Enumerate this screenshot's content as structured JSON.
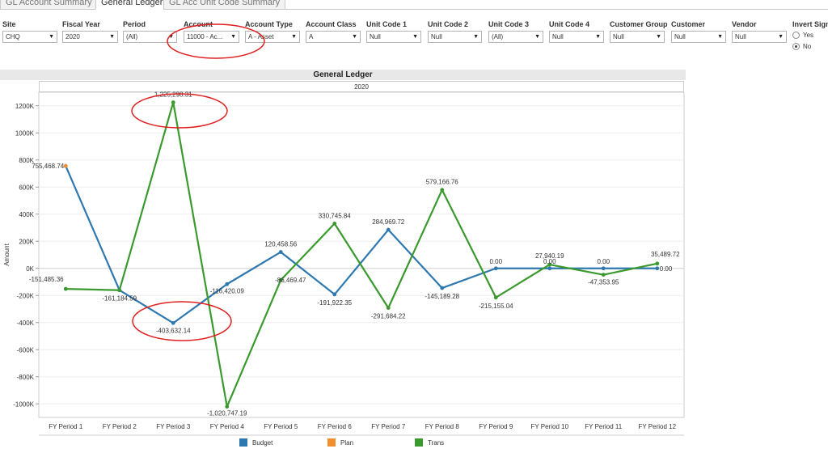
{
  "tabs": [
    {
      "label": "GL Account Summary",
      "active": false
    },
    {
      "label": "General Ledger",
      "active": true
    },
    {
      "label": "GL Acc Unit Code Summary",
      "active": false
    }
  ],
  "filters": [
    {
      "label": "Site",
      "value": "CHQ"
    },
    {
      "label": "Fiscal Year",
      "value": "2020"
    },
    {
      "label": "Period",
      "value": "(All)"
    },
    {
      "label": "Account",
      "value": "11000 - Ac..."
    },
    {
      "label": "Account Type",
      "value": "A - Asset"
    },
    {
      "label": "Account Class",
      "value": "A"
    },
    {
      "label": "Unit Code 1",
      "value": "Null"
    },
    {
      "label": "Unit Code 2",
      "value": "Null"
    },
    {
      "label": "Unit Code 3",
      "value": "(All)"
    },
    {
      "label": "Unit Code 4",
      "value": "Null"
    },
    {
      "label": "Customer Group",
      "value": "Null"
    },
    {
      "label": "Customer",
      "value": "Null"
    },
    {
      "label": "Vendor",
      "value": "Null"
    }
  ],
  "invert_sign": {
    "label": "Invert Sign",
    "options": [
      "Yes",
      "No"
    ],
    "selected": "No"
  },
  "chart_data": {
    "type": "line",
    "title": "General Ledger",
    "subtitle": "2020",
    "xlabel": "",
    "ylabel": "Amount",
    "ylim": [
      -1000000,
      1200000
    ],
    "yticks": [
      {
        "value": 1200000,
        "label": "1200K"
      },
      {
        "value": 1000000,
        "label": "1000K"
      },
      {
        "value": 800000,
        "label": "800K"
      },
      {
        "value": 600000,
        "label": "600K"
      },
      {
        "value": 400000,
        "label": "400K"
      },
      {
        "value": 200000,
        "label": "200K"
      },
      {
        "value": 0,
        "label": "0K"
      },
      {
        "value": -200000,
        "label": "-200K"
      },
      {
        "value": -400000,
        "label": "-400K"
      },
      {
        "value": -600000,
        "label": "-600K"
      },
      {
        "value": -800000,
        "label": "-800K"
      },
      {
        "value": -1000000,
        "label": "-1000K"
      }
    ],
    "categories": [
      "FY Period 1",
      "FY Period 2",
      "FY Period 3",
      "FY Period 4",
      "FY Period 5",
      "FY Period 6",
      "FY Period 7",
      "FY Period 8",
      "FY Period 9",
      "FY Period 10",
      "FY Period 11",
      "FY Period 12"
    ],
    "series": [
      {
        "name": "Budget",
        "color": "#2e78b0",
        "values": [
          755468.74,
          -161184.59,
          -403632.14,
          -116420.09,
          120458.56,
          -191922.35,
          284969.72,
          -145189.28,
          0,
          0,
          0,
          0
        ],
        "labels": [
          "",
          "-161,184.59",
          "-403,632.14",
          "-116,420.09",
          "120,458.56",
          "-191,922.35",
          "284,969.72",
          "-145,189.28",
          "0.00",
          "0.00",
          "0.00",
          "0.00"
        ]
      },
      {
        "name": "Plan",
        "color": "#f28e2b",
        "values": [
          755468.74
        ],
        "labels": [
          "755,468.74"
        ]
      },
      {
        "name": "Trans",
        "color": "#3a9a2e",
        "values": [
          -151485.36,
          -161184.59,
          1225298.31,
          -1020747.19,
          -86469.47,
          330745.84,
          -291684.22,
          579166.76,
          -215155.04,
          27940.19,
          -47353.95,
          35489.72
        ],
        "labels": [
          "-151,485.36",
          "",
          "1,225,298.31",
          "-1,020,747.19",
          "-86,469.47",
          "330,745.84",
          "-291,684.22",
          "579,166.76",
          "-215,155.04",
          "27,940.19",
          "-47,353.95",
          "35,489.72"
        ]
      }
    ],
    "legend": "bottom"
  },
  "annotations": {
    "color": "#e02020"
  }
}
